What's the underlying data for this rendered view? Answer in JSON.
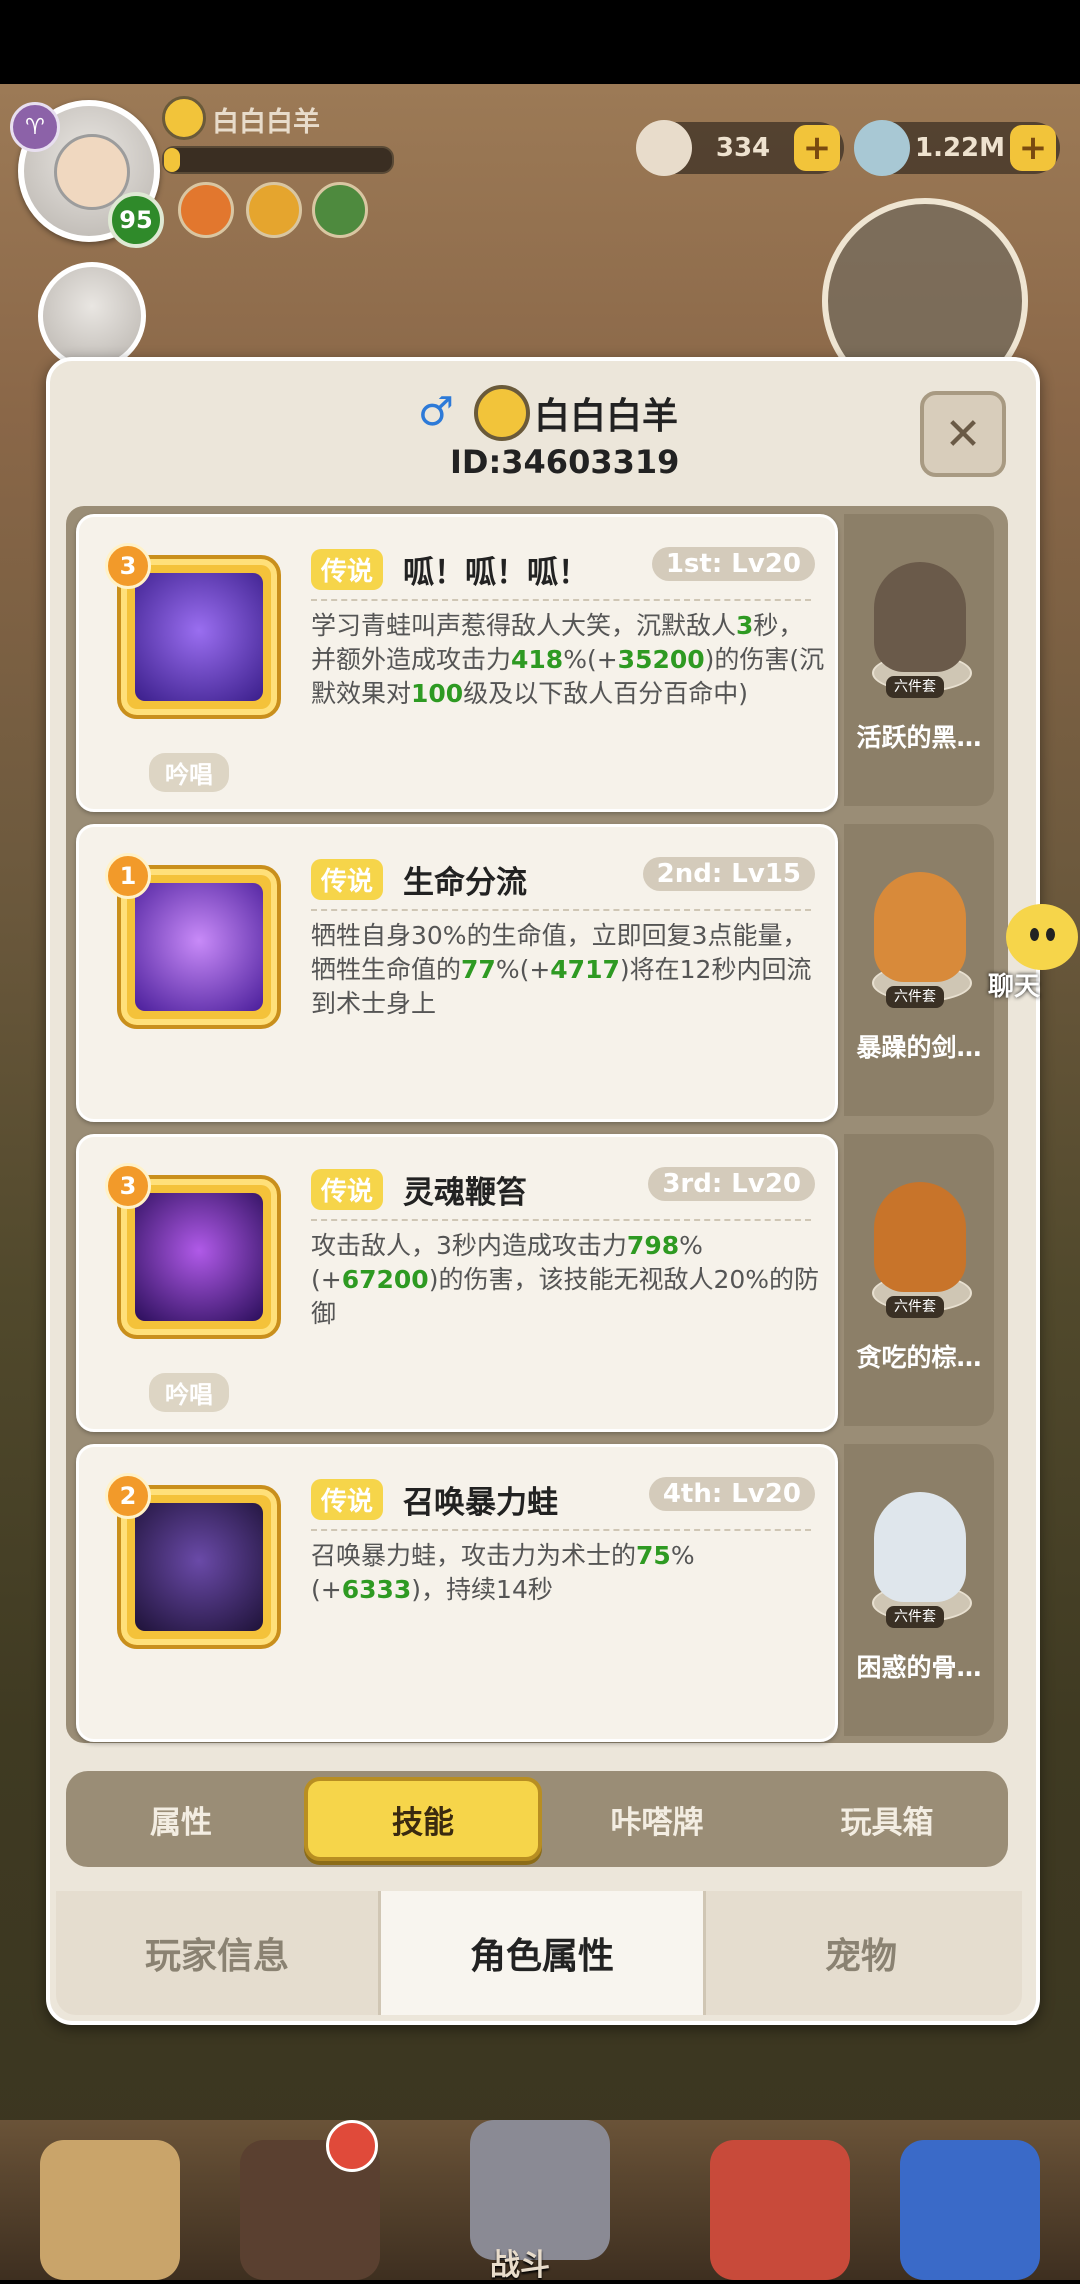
{
  "hud": {
    "player_name": "白白白羊",
    "player_level": "95",
    "zodiac_symbol": "♈",
    "currency1": "334",
    "currency2": "1.22M",
    "plus": "+"
  },
  "panel": {
    "gender_symbol": "♂",
    "player_name": "白白白羊",
    "player_id": "ID:34603319",
    "close_symbol": "✕"
  },
  "skills": [
    {
      "level_badge": "3",
      "tag": "传说",
      "name": "呱！呱！呱！",
      "slot": "1st: Lv20",
      "desc_parts": [
        "学习青蛙叫声惹得敌人大笑，沉默敌人",
        "3",
        "秒，并额外造成攻击力",
        "418",
        "%(+",
        "35200",
        ")的伤害(沉默效果对",
        "100",
        "级及以下敌人百分百命中)"
      ],
      "chant": "吟唱",
      "icon_color": "#6a3ec8"
    },
    {
      "level_badge": "1",
      "tag": "传说",
      "name": "生命分流",
      "slot": "2nd: Lv15",
      "desc_parts": [
        "牺牲自身30%的生命值，立即回复3点能量，牺牲生命值的",
        "77",
        "%(+",
        "4717",
        ")将在12秒内回流到术士身上"
      ],
      "chant": "",
      "icon_color": "#7a3ed8"
    },
    {
      "level_badge": "3",
      "tag": "传说",
      "name": "灵魂鞭笞",
      "slot": "3rd: Lv20",
      "desc_parts": [
        "攻击敌人，3秒内造成攻击力",
        "798",
        "%(+",
        "67200",
        ")的伤害，该技能无视敌人20%的防御"
      ],
      "chant": "吟唱",
      "icon_color": "#5a2aa8"
    },
    {
      "level_badge": "2",
      "tag": "传说",
      "name": "召唤暴力蛙",
      "slot": "4th: Lv20",
      "desc_parts": [
        "召唤暴力蛙，攻击力为术士的",
        "75",
        "%(+",
        "6333",
        ")，持续14秒"
      ],
      "chant": "",
      "icon_color": "#3a2a6a"
    }
  ],
  "pets": [
    {
      "name": "活跃的黑…",
      "suit": "六件套",
      "color": "#6a5a4a"
    },
    {
      "name": "暴躁的剑…",
      "suit": "六件套",
      "color": "#d88a3a"
    },
    {
      "name": "贪吃的棕…",
      "suit": "六件套",
      "color": "#c8742a"
    },
    {
      "name": "困惑的骨…",
      "suit": "六件套",
      "color": "#dfe6ec"
    }
  ],
  "tabs": [
    "属性",
    "技能",
    "咔嗒牌",
    "玩具箱"
  ],
  "bottom_tabs": [
    "玩家信息",
    "角色属性",
    "宠物"
  ],
  "chat": {
    "label": "聊天"
  },
  "nav": {
    "battle_label": "战斗"
  }
}
